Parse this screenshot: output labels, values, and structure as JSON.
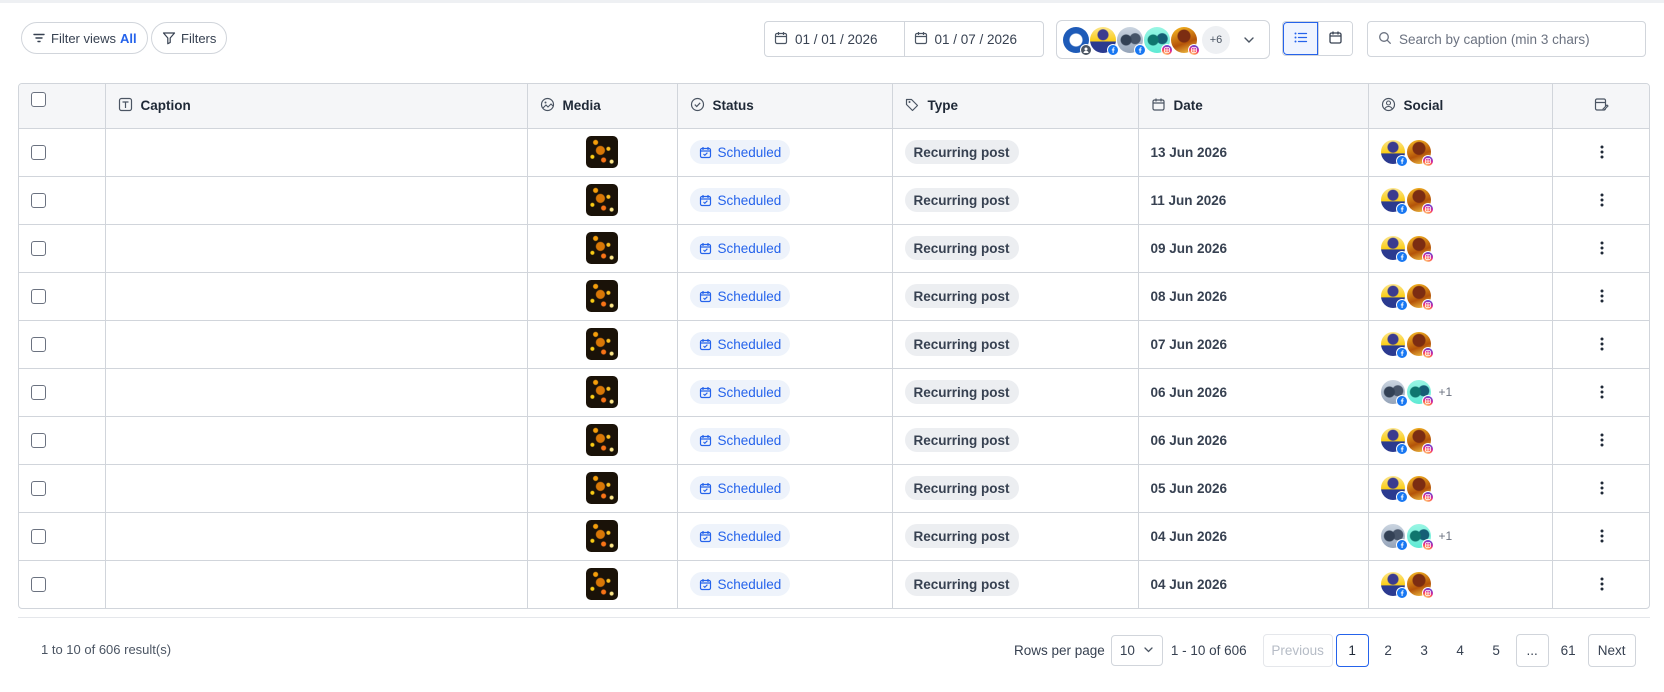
{
  "toolbar": {
    "filter_views_label": "Filter views",
    "filter_views_value": "All",
    "filters_label": "Filters",
    "date_from": "01 / 01 / 2026",
    "date_to": "01 / 07 / 2026",
    "accounts_more": "+6",
    "search_placeholder": "Search by caption (min 3 chars)"
  },
  "table": {
    "headers": {
      "caption": "Caption",
      "media": "Media",
      "status": "Status",
      "type": "Type",
      "date": "Date",
      "social": "Social"
    },
    "rows": [
      {
        "caption": "",
        "status": "Scheduled",
        "type": "Recurring post",
        "date": "13 Jun 2026",
        "social_extra": ""
      },
      {
        "caption": "",
        "status": "Scheduled",
        "type": "Recurring post",
        "date": "11 Jun 2026",
        "social_extra": ""
      },
      {
        "caption": "",
        "status": "Scheduled",
        "type": "Recurring post",
        "date": "09 Jun 2026",
        "social_extra": ""
      },
      {
        "caption": "",
        "status": "Scheduled",
        "type": "Recurring post",
        "date": "08 Jun 2026",
        "social_extra": ""
      },
      {
        "caption": "",
        "status": "Scheduled",
        "type": "Recurring post",
        "date": "07 Jun 2026",
        "social_extra": ""
      },
      {
        "caption": "",
        "status": "Scheduled",
        "type": "Recurring post",
        "date": "06 Jun 2026",
        "social_extra": "+1"
      },
      {
        "caption": "",
        "status": "Scheduled",
        "type": "Recurring post",
        "date": "06 Jun 2026",
        "social_extra": ""
      },
      {
        "caption": "",
        "status": "Scheduled",
        "type": "Recurring post",
        "date": "05 Jun 2026",
        "social_extra": ""
      },
      {
        "caption": "",
        "status": "Scheduled",
        "type": "Recurring post",
        "date": "04 Jun 2026",
        "social_extra": "+1"
      },
      {
        "caption": "",
        "status": "Scheduled",
        "type": "Recurring post",
        "date": "04 Jun 2026",
        "social_extra": ""
      }
    ]
  },
  "footer": {
    "result_count": "1 to 10 of 606 result(s)",
    "rows_per_page_label": "Rows per page",
    "rows_per_page_value": "10",
    "range_label": "1 - 10 of 606",
    "previous_label": "Previous",
    "next_label": "Next",
    "pages": [
      "1",
      "2",
      "3",
      "4",
      "5",
      "...",
      "61"
    ],
    "current_page": "1"
  },
  "colors": {
    "accent": "#2563eb",
    "status_bg": "#eef3fb",
    "header_bg": "#f5f6f8"
  },
  "icons": {
    "filter_views": "filter-lines-icon",
    "filters": "funnel-icon",
    "date": "calendar-icon",
    "list_view": "list-icon",
    "calendar_view": "calendar-icon",
    "search": "search-icon",
    "caption": "text-icon",
    "media": "image-icon",
    "status": "check-circle-icon",
    "type": "tag-icon",
    "date_col": "calendar-icon",
    "social": "user-circle-icon",
    "column_settings": "edit-columns-icon",
    "row_actions": "kebab-icon"
  }
}
